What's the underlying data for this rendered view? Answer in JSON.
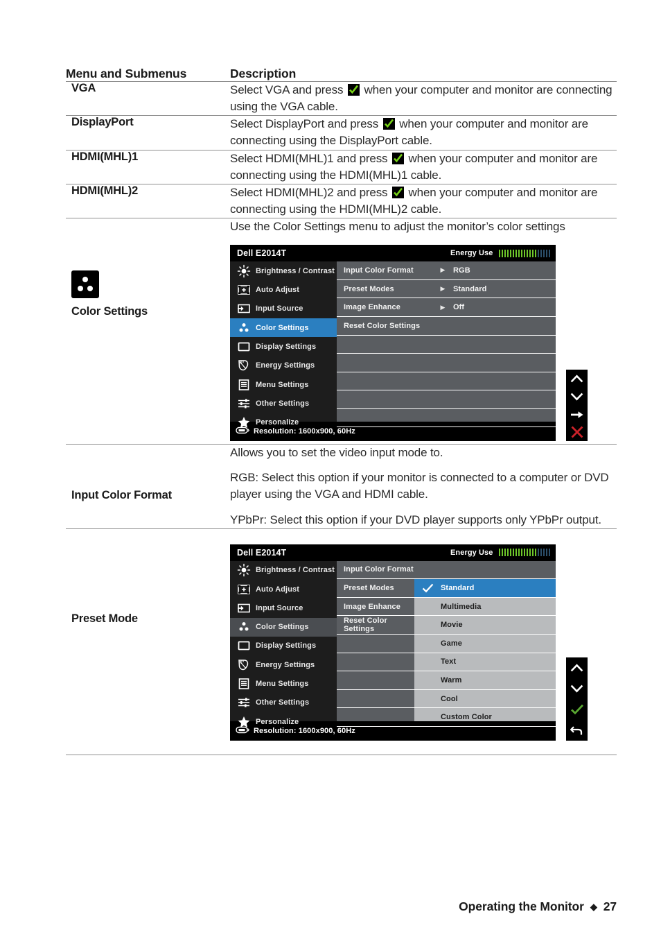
{
  "table": {
    "headers": {
      "menu": "Menu and Submenus",
      "description": "Description"
    },
    "rows": [
      {
        "label": "VGA",
        "paras": [
          {
            "pre": "Select VGA and press ",
            "icon": "green-check",
            "post": " when your computer and monitor are connecting using the VGA cable."
          }
        ]
      },
      {
        "label": "DisplayPort",
        "paras": [
          {
            "pre": "Select DisplayPort and press ",
            "icon": "green-check",
            "post": " when your computer and monitor are connecting using the DisplayPort cable."
          }
        ]
      },
      {
        "label": "HDMI(MHL)1",
        "paras": [
          {
            "pre": "Select HDMI(MHL)1 and press ",
            "icon": "green-check",
            "post": " when your computer and monitor are connecting using the HDMI(MHL)1 cable."
          }
        ]
      },
      {
        "label": "HDMI(MHL)2",
        "paras": [
          {
            "pre": "Select HDMI(MHL)2 and press ",
            "icon": "green-check",
            "post": " when your computer and monitor are connecting using the HDMI(MHL)2 cable."
          }
        ]
      },
      {
        "label": "Color Settings",
        "icon": "color-settings-icon",
        "intro": "Use the Color Settings menu to adjust the monitor’s color settings"
      },
      {
        "label": "Input Color Format",
        "paras": [
          {
            "text": "Allows you to set the video input mode to."
          },
          {
            "text": "RGB: Select this option if your monitor is connected to a computer or DVD player using the VGA and HDMI cable."
          },
          {
            "text": "YPbPr: Select this option if your DVD player supports only YPbPr output."
          }
        ]
      },
      {
        "label": "Preset Mode"
      }
    ]
  },
  "osd_common": {
    "brand": "Dell E2014T",
    "energy_use_label": "Energy Use",
    "energy_bars_green": 14,
    "energy_bars_dim": 5,
    "energy_green": "#6ec72a",
    "energy_dim": "#2c4f6b",
    "resolution": "Resolution:  1600x900, 60Hz",
    "sidebar": [
      {
        "label": "Brightness / Contrast",
        "icon": "brightness-icon"
      },
      {
        "label": "Auto Adjust",
        "icon": "auto-adjust-icon"
      },
      {
        "label": "Input Source",
        "icon": "input-source-icon"
      },
      {
        "label": "Color Settings",
        "icon": "color-settings-icon"
      },
      {
        "label": "Display Settings",
        "icon": "display-settings-icon"
      },
      {
        "label": "Energy Settings",
        "icon": "energy-settings-icon"
      },
      {
        "label": "Menu Settings",
        "icon": "menu-settings-icon"
      },
      {
        "label": "Other Settings",
        "icon": "other-settings-icon"
      },
      {
        "label": "Personalize",
        "icon": "star-icon"
      }
    ],
    "selected_sidebar_index": 3,
    "accent": "#2b7fc0"
  },
  "osd_color_settings": {
    "rows": [
      {
        "name": "Input Color Format",
        "arrow": "▶",
        "value": "RGB"
      },
      {
        "name": "Preset Modes",
        "arrow": "▶",
        "value": "Standard"
      },
      {
        "name": "Image Enhance",
        "arrow": "▶",
        "value": "Off"
      },
      {
        "name": "Reset Color Settings",
        "arrow": "",
        "value": ""
      },
      {
        "name": "",
        "arrow": "",
        "value": ""
      },
      {
        "name": "",
        "arrow": "",
        "value": ""
      },
      {
        "name": "",
        "arrow": "",
        "value": ""
      },
      {
        "name": "",
        "arrow": "",
        "value": ""
      },
      {
        "name": "",
        "arrow": "",
        "value": ""
      }
    ],
    "nav": [
      {
        "icon": "chevron-up-icon",
        "color": "#ffffff"
      },
      {
        "icon": "chevron-down-icon",
        "color": "#ffffff"
      },
      {
        "icon": "arrow-right-icon",
        "color": "#ffffff"
      },
      {
        "icon": "close-x-icon",
        "color": "#cc2229"
      }
    ]
  },
  "osd_preset_mode": {
    "middle_rows": [
      "Input Color Format",
      "Preset Modes",
      "Image Enhance",
      "Reset Color Settings",
      "",
      "",
      "",
      "",
      ""
    ],
    "options": [
      {
        "label": "Standard",
        "selected": true
      },
      {
        "label": "Multimedia",
        "selected": false
      },
      {
        "label": "Movie",
        "selected": false
      },
      {
        "label": "Game",
        "selected": false
      },
      {
        "label": "Text",
        "selected": false
      },
      {
        "label": "Warm",
        "selected": false
      },
      {
        "label": "Cool",
        "selected": false
      },
      {
        "label": "Custom Color",
        "selected": false
      }
    ],
    "nav": [
      {
        "icon": "chevron-up-icon",
        "color": "#ffffff"
      },
      {
        "icon": "chevron-down-icon",
        "color": "#ffffff"
      },
      {
        "icon": "check-icon",
        "color": "#5aa832"
      },
      {
        "icon": "back-arrow-icon",
        "color": "#ffffff"
      }
    ]
  },
  "footer": {
    "section": "Operating the Monitor",
    "separator": "◆",
    "page": "27"
  }
}
